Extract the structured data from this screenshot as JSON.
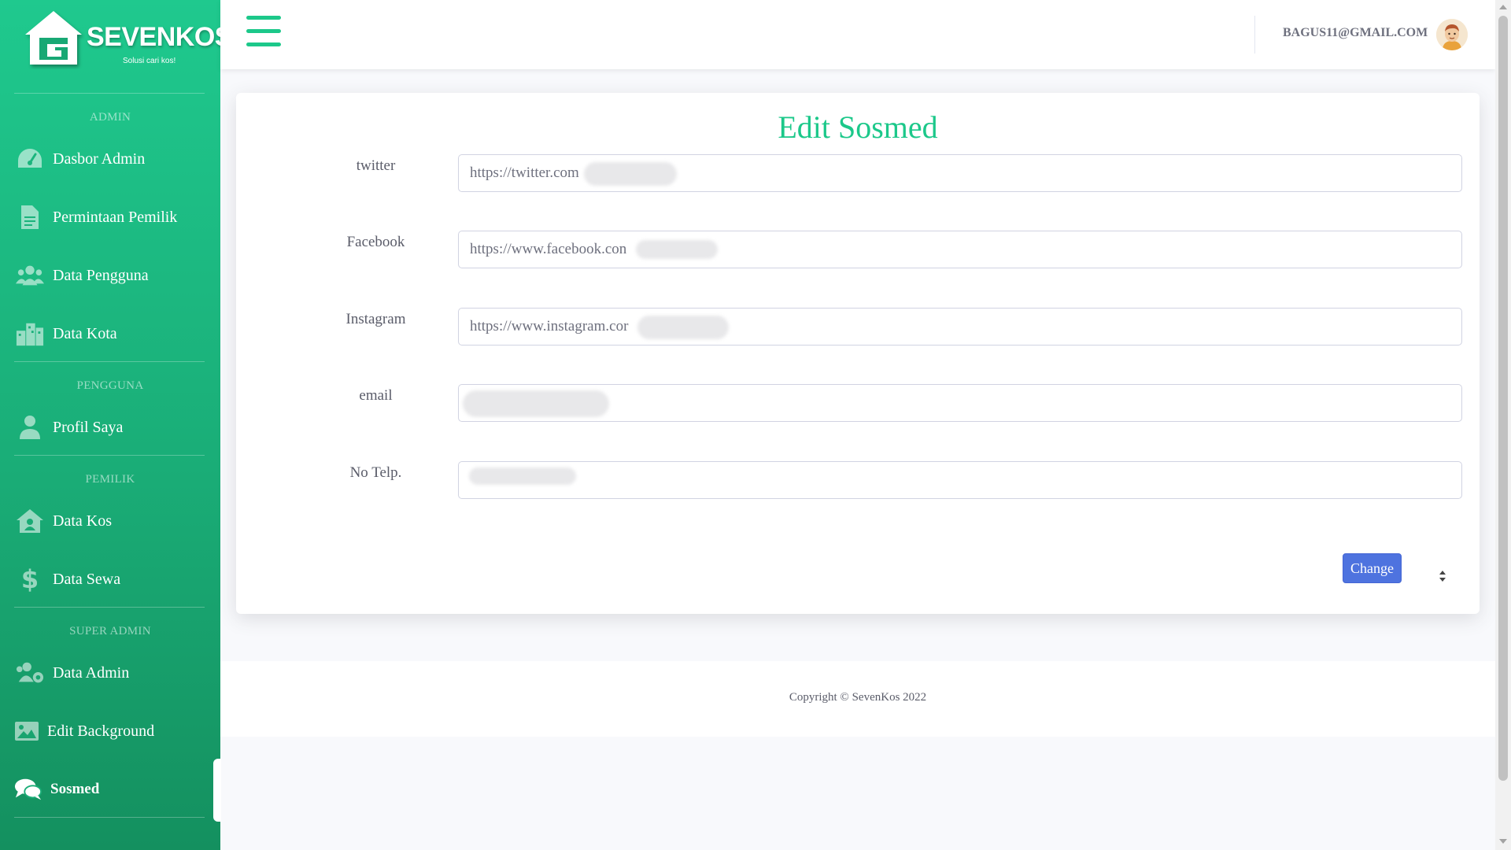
{
  "brand": {
    "name": "SEVENKOS",
    "tagline": "Solusi cari kos!"
  },
  "sidebar": {
    "headings": {
      "admin": "ADMIN",
      "pengguna": "PENGGUNA",
      "pemilik": "PEMILIK",
      "super_admin": "SUPER ADMIN"
    },
    "items": [
      {
        "label": "Dasbor Admin",
        "icon": "tachometer-icon"
      },
      {
        "label": "Permintaan Pemilik",
        "icon": "file-icon"
      },
      {
        "label": "Data Pengguna",
        "icon": "users-icon"
      },
      {
        "label": "Data Kota",
        "icon": "city-icon"
      },
      {
        "label": "Profil Saya",
        "icon": "user-icon"
      },
      {
        "label": "Data Kos",
        "icon": "house-user-icon"
      },
      {
        "label": "Data Sewa",
        "icon": "dollar-icon"
      },
      {
        "label": "Data Admin",
        "icon": "users-cog-icon"
      },
      {
        "label": "Edit Background",
        "icon": "image-icon"
      },
      {
        "label": "Sosmed",
        "icon": "comments-icon",
        "active": true
      }
    ]
  },
  "topbar": {
    "user_email": "BAGUS11@GMAIL.COM"
  },
  "form": {
    "title": "Edit Sosmed",
    "fields": [
      {
        "label": "twitter",
        "value": "https://twitter.com"
      },
      {
        "label": "Facebook",
        "value": "https://www.facebook.con"
      },
      {
        "label": "Instagram",
        "value": "https://www.instagram.cor"
      },
      {
        "label": "email",
        "value": ""
      },
      {
        "label": "No Telp.",
        "value": ""
      }
    ],
    "submit_label": "Change"
  },
  "footer": {
    "copyright": "Copyright © SevenKos 2022"
  },
  "colors": {
    "primary_green": "#1cc88a",
    "button_blue": "#4e73df",
    "sidebar_dark": "#14905f"
  }
}
